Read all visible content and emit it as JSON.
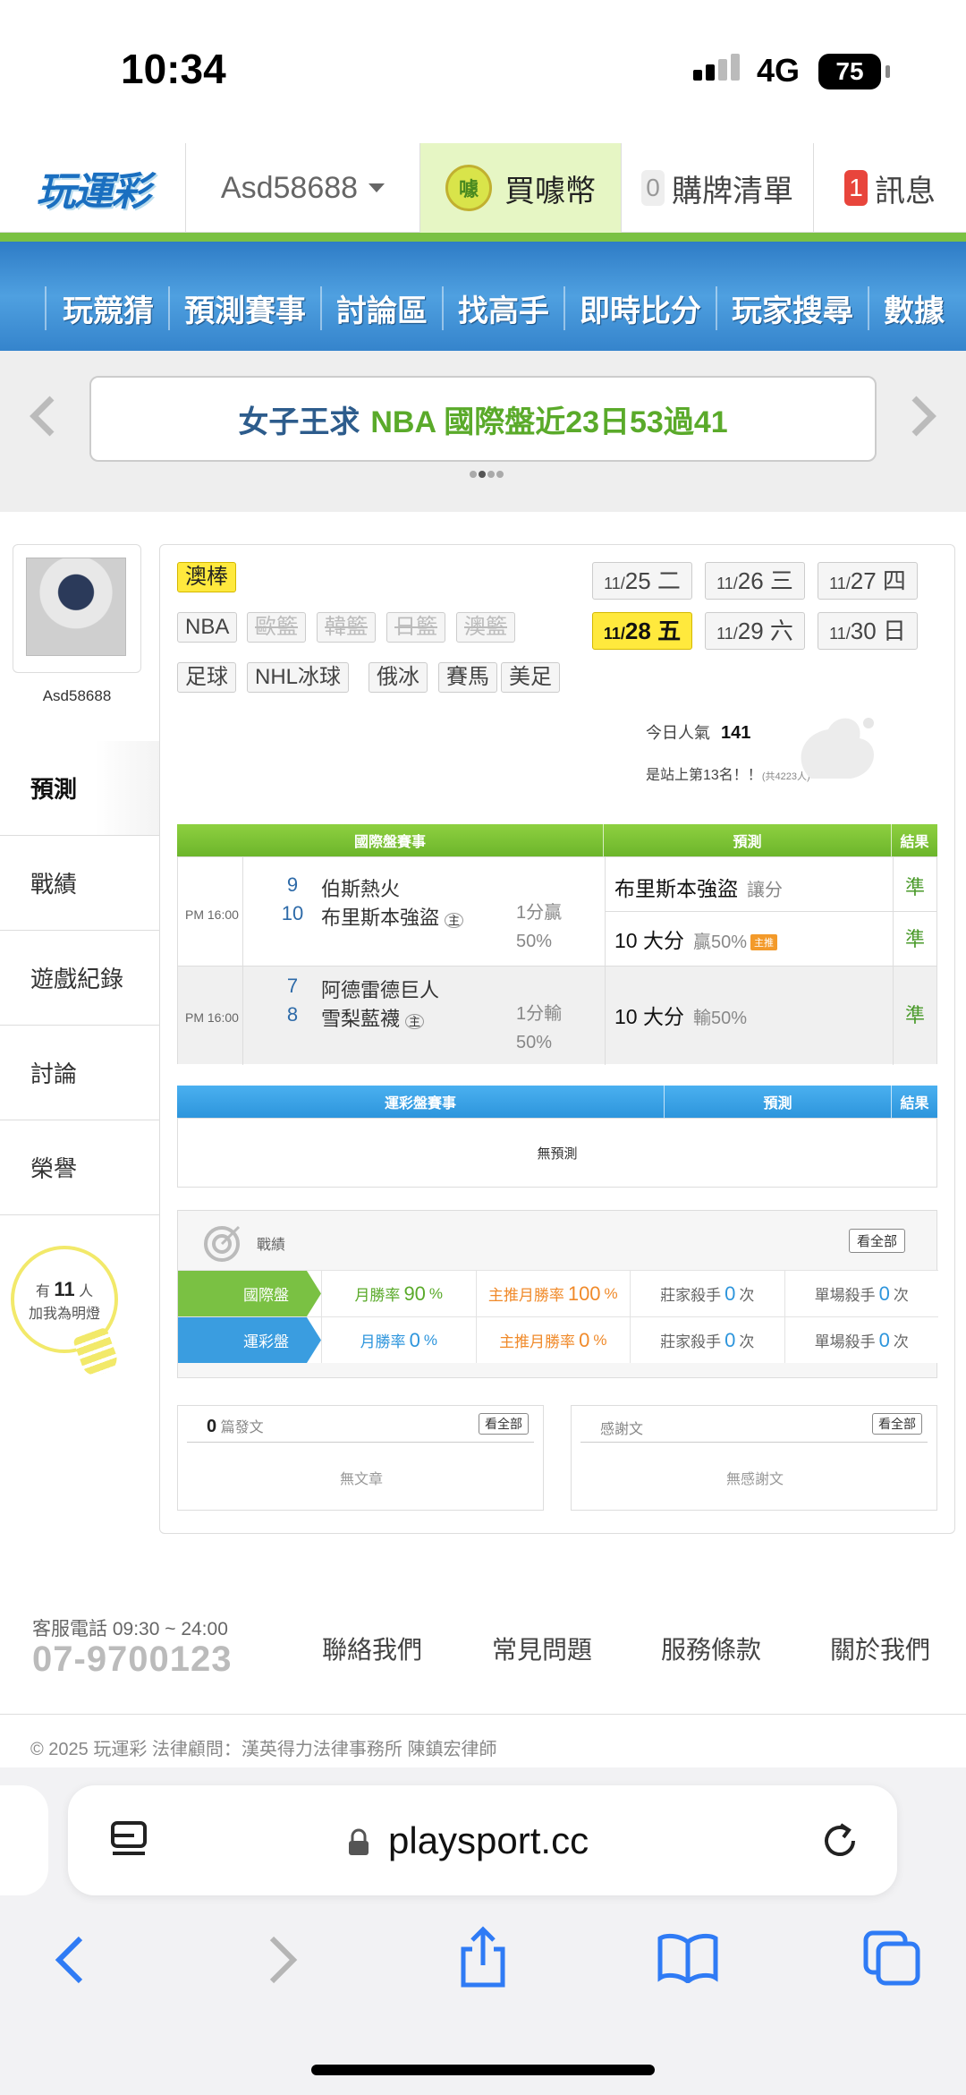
{
  "status_bar": {
    "time": "10:34",
    "network": "4G",
    "battery": "75"
  },
  "header": {
    "logo": "玩運彩",
    "username": "Asd58688",
    "buy_coin_label": "買噱幣",
    "coin_icon_text": "噱",
    "cart_count": "0",
    "cart_label": "購牌清單",
    "msg_count": "1",
    "msg_label": "訊息"
  },
  "nav": [
    "玩競猜",
    "預測賽事",
    "討論區",
    "找高手",
    "即時比分",
    "玩家搜尋",
    "數據"
  ],
  "banner": {
    "part1": "女子王求",
    "part2": "NBA 國際盤近23日53過41"
  },
  "profile": {
    "name": "Asd58688",
    "menu": [
      "預測",
      "戰績",
      "遊戲紀錄",
      "討論",
      "榮譽"
    ],
    "fans": {
      "pre": "有",
      "count": "11",
      "post": "人",
      "line2": "加我為明燈"
    }
  },
  "sports": {
    "selected": "澳棒",
    "row1": [
      {
        "label": "NBA",
        "disabled": false
      },
      {
        "label": "歐籃",
        "disabled": true
      },
      {
        "label": "韓籃",
        "disabled": true
      },
      {
        "label": "日籃",
        "disabled": true
      },
      {
        "label": "澳籃",
        "disabled": true
      }
    ],
    "row2": [
      {
        "label": "足球",
        "disabled": false
      },
      {
        "label": "NHL冰球",
        "disabled": false
      },
      {
        "label": "俄冰",
        "disabled": false
      },
      {
        "label": "賽馬",
        "disabled": false
      },
      {
        "label": "美足",
        "disabled": false
      }
    ]
  },
  "dates": [
    {
      "md": "11/",
      "d": "25",
      "wd": "二",
      "selected": false
    },
    {
      "md": "11/",
      "d": "26",
      "wd": "三",
      "selected": false
    },
    {
      "md": "11/",
      "d": "27",
      "wd": "四",
      "selected": false
    },
    {
      "md": "11/",
      "d": "28",
      "wd": "五",
      "selected": true
    },
    {
      "md": "11/",
      "d": "29",
      "wd": "六",
      "selected": false
    },
    {
      "md": "11/",
      "d": "30",
      "wd": "日",
      "selected": false
    }
  ],
  "popularity": {
    "label": "今日人氣",
    "value": "141",
    "rank_text": "是站上第13名！！",
    "rank_total": "(共4223人)"
  },
  "intl_table": {
    "headers": [
      "國際盤賽事",
      "預測",
      "結果"
    ],
    "games": [
      {
        "time": "PM 16:00",
        "away_num": "9",
        "away": "伯斯熱火",
        "home_num": "10",
        "home": "布里斯本強盜",
        "home_mark": "主",
        "line1": "1分贏",
        "line2": "50%",
        "preds": [
          {
            "main": "布里斯本強盜",
            "sub": "讓分",
            "hot": "",
            "result": "準"
          },
          {
            "main": "10 大分",
            "sub": "贏50%",
            "hot": "主推",
            "result": "準"
          }
        ]
      },
      {
        "time": "PM 16:00",
        "away_num": "7",
        "away": "阿德雷德巨人",
        "home_num": "8",
        "home": "雪梨藍襪",
        "home_mark": "主",
        "line1": "1分輸",
        "line2": "50%",
        "preds": [
          {
            "main": "10 大分",
            "sub": "輸50%",
            "hot": "",
            "result": "準"
          }
        ]
      }
    ]
  },
  "lottery_table": {
    "headers": [
      "運彩盤賽事",
      "預測",
      "結果"
    ],
    "empty": "無預測"
  },
  "record": {
    "title": "戰績",
    "view_all": "看全部",
    "rows": [
      {
        "label": "國際盤",
        "month_rate_label": "月勝率",
        "month_rate": "90",
        "main_rate_label": "主推月勝率",
        "main_rate": "100",
        "pct": "%",
        "banker_label": "莊家殺手",
        "banker": "0",
        "single_label": "單場殺手",
        "single": "0",
        "times": "次",
        "color": "#7ac143"
      },
      {
        "label": "運彩盤",
        "month_rate_label": "月勝率",
        "month_rate": "0",
        "main_rate_label": "主推月勝率",
        "main_rate": "0",
        "pct": "%",
        "banker_label": "莊家殺手",
        "banker": "0",
        "single_label": "單場殺手",
        "single": "0",
        "times": "次",
        "color": "#3a9de0"
      }
    ]
  },
  "articles": {
    "count": "0",
    "label": "篇發文",
    "view_all": "看全部",
    "empty": "無文章"
  },
  "thanks": {
    "label": "感謝文",
    "view_all": "看全部",
    "empty": "無感謝文"
  },
  "footer": {
    "hours": "客服電話 09:30 ~ 24:00",
    "phone": "07-9700123",
    "links": [
      "聯絡我們",
      "常見問題",
      "服務條款",
      "關於我們"
    ],
    "copyright": "© 2025 玩運彩 法律顧問：漢英得力法律事務所 陳鎮宏律師"
  },
  "browser": {
    "url": "playsport.cc"
  }
}
